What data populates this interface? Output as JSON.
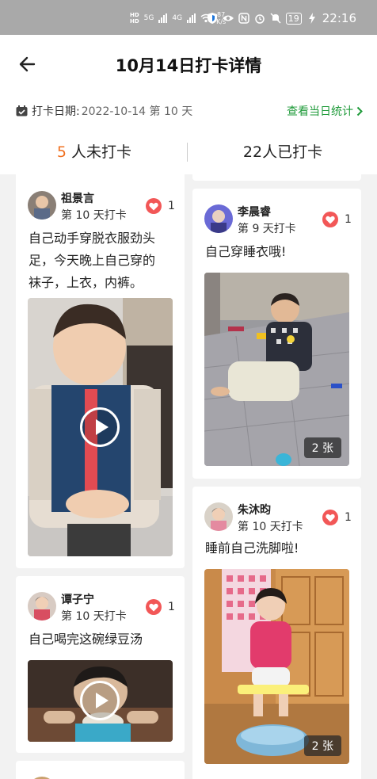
{
  "status_bar": {
    "time": "22:16",
    "net_speed": "87",
    "net_unit": "K/s",
    "battery": "19",
    "hd1": "HD",
    "hd2": "HD",
    "sig1": "5G",
    "sig2": "4G"
  },
  "header": {
    "title": "10月14日打卡详情",
    "date_label": "打卡日期:",
    "date_value": "2022-10-14 第 10 天",
    "stats_link": "查看当日统计"
  },
  "tabs": {
    "unchecked_count": "5",
    "unchecked_label": " 人未打卡",
    "checked_label": "22人已打卡"
  },
  "posts": [
    {
      "name": "祖景言",
      "day": "第 10 天打卡",
      "likes": "1",
      "text_lines": [
        "自己动手穿脱衣服劲头",
        "足，今天晚上自己穿的",
        "袜子，上衣，内裤。"
      ],
      "media": "video"
    },
    {
      "name": "谭子宁",
      "day": "第 10 天打卡",
      "likes": "1",
      "text_lines": [
        "自己喝完这碗绿豆汤"
      ],
      "media": "video"
    },
    {
      "name": "李晨睿",
      "day": "第 9 天打卡",
      "likes": "1",
      "text_lines": [
        "自己穿睡衣哦!"
      ],
      "media": "image",
      "image_count": "2 张"
    },
    {
      "name": "朱沐昀",
      "day": "第 10 天打卡",
      "likes": "1",
      "text_lines": [
        "睡前自己洗脚啦!"
      ],
      "media": "image",
      "image_count": "2 张"
    }
  ],
  "colors": {
    "accent_green": "#1e9a39",
    "accent_orange": "#f07020",
    "heart_red": "#f25757"
  }
}
